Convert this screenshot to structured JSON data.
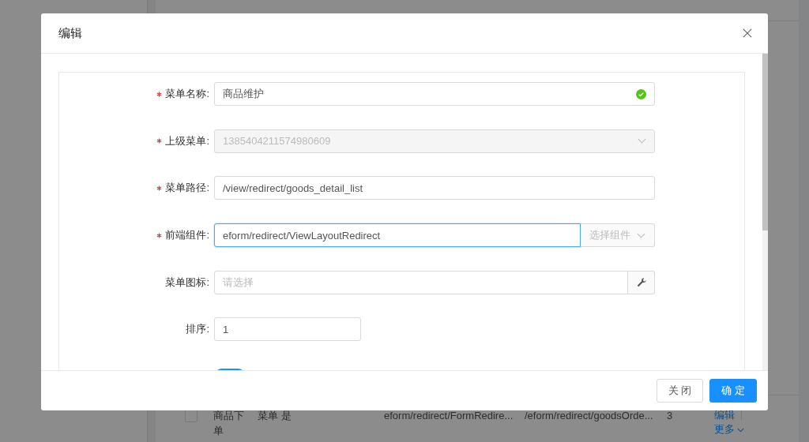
{
  "background_table": {
    "bottom_row": {
      "checked": false,
      "name": "商品下单",
      "type": "菜单",
      "column_4": "是",
      "component": "eform/redirect/FormRedire...",
      "path": "/eform/redirect/goodsOrde...",
      "sort": "3",
      "actions": [
        "编辑",
        "更多"
      ]
    }
  },
  "dialog": {
    "title": "编辑",
    "fields": [
      {
        "kind": "text",
        "label": "菜单名称:",
        "required": true,
        "value": "商品维护",
        "valid": true
      },
      {
        "kind": "select",
        "label": "上级菜单:",
        "required": true,
        "value": "1385404211574980609",
        "disabled": true
      },
      {
        "kind": "text",
        "label": "菜单路径:",
        "required": true,
        "value": "/view/redirect/goods_detail_list",
        "valid": false
      },
      {
        "kind": "addon-select",
        "label": "前端组件:",
        "required": true,
        "value": "eform/redirect/ViewLayoutRedirect",
        "focused": true,
        "addon": "选择组件"
      },
      {
        "kind": "icon-picker",
        "label": "菜单图标:",
        "required": false,
        "placeholder": "请选择"
      },
      {
        "kind": "number",
        "label": "排序:",
        "required": false,
        "value": "1"
      },
      {
        "kind": "switch",
        "on": true
      }
    ],
    "buttons": [
      {
        "label": "关 闭",
        "kind": "default"
      },
      {
        "label": "确 定",
        "kind": "primary"
      }
    ]
  }
}
